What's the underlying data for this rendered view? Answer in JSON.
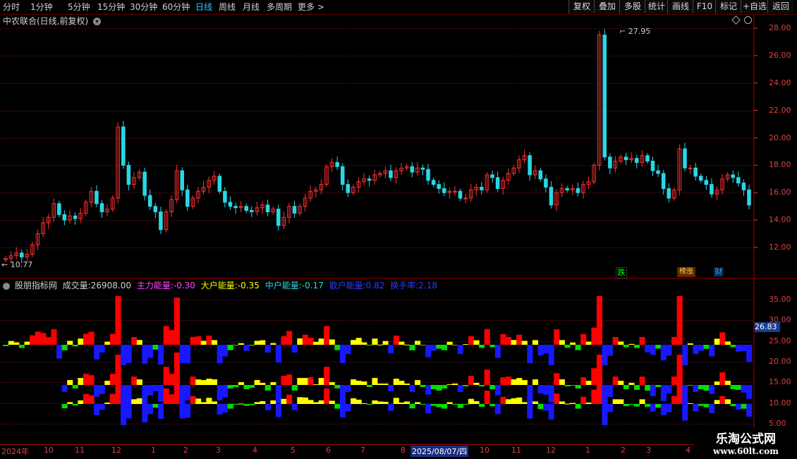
{
  "toolbar": {
    "timeframes": [
      "分时",
      "1分钟",
      "5分钟",
      "15分钟",
      "30分钟",
      "60分钟",
      "日线",
      "周线",
      "月线",
      "多周期",
      "更多 >"
    ],
    "active_timeframe": "日线",
    "buttons": [
      "复权",
      "叠加",
      "多股",
      "统计",
      "画线",
      "F10",
      "标记",
      "+自选",
      "返回"
    ]
  },
  "main_panel": {
    "title": "中农联合(日线,前复权)",
    "y_ticks": [
      "28.00",
      "26.00",
      "24.00",
      "22.00",
      "20.00",
      "18.00",
      "16.00",
      "14.00",
      "12.00"
    ],
    "high_label": "27.95",
    "low_label": "10.77",
    "markers": {
      "die": "跌",
      "bangzhang": "榜涨",
      "cai": "财"
    }
  },
  "indicator_panel": {
    "name": "股朋指标网",
    "volume_label": "成交量:",
    "volume_value": "26908.00",
    "zhuli_label": "主力能量:",
    "zhuli_value": "-0.30",
    "dahu_label": "大户能量:",
    "dahu_value": "-0.35",
    "zhonghu_label": "中户能量:",
    "zhonghu_value": "-0.17",
    "sanhu_label": "散户能量:",
    "sanhu_value": "0.82",
    "huanshou_label": "换手率:",
    "huanshou_value": "2.18",
    "y_ticks": [
      "35.00",
      "30.00",
      "25.00",
      "20.00",
      "15.00",
      "10.00",
      "5.00"
    ],
    "current_value": "26.83"
  },
  "x_axis": {
    "labels": [
      "2024年",
      "10",
      "11",
      "12",
      "1",
      "2",
      "3",
      "4",
      "5",
      "6",
      "7",
      "8",
      "2025/08/07/四",
      "10",
      "11",
      "12",
      "1",
      "2",
      "3",
      "4"
    ]
  },
  "watermark": {
    "line1": "乐淘公式网",
    "line2": "www.60lt.com"
  },
  "colors": {
    "up": "#ff3030",
    "down": "#2ad6e6",
    "yellow": "#ffff00",
    "green": "#00e000",
    "blue": "#1818ff",
    "red": "#ff0000",
    "axis": "#e04040"
  },
  "chart_data": {
    "type": "candlestick",
    "title": "中农联合(日线,前复权)",
    "ylim": [
      10.5,
      29
    ],
    "high": 27.95,
    "low": 10.77,
    "closes": [
      11.2,
      11.4,
      11.6,
      11.3,
      11.5,
      12.2,
      13.0,
      13.8,
      14.2,
      15.2,
      14.4,
      14.0,
      14.3,
      14.1,
      14.5,
      15.3,
      16.1,
      15.2,
      14.6,
      14.8,
      15.6,
      20.8,
      18.0,
      16.6,
      17.1,
      17.5,
      15.8,
      15.0,
      14.6,
      13.3,
      14.6,
      15.5,
      17.6,
      16.2,
      15.0,
      15.6,
      16.1,
      16.4,
      16.9,
      17.2,
      16.1,
      15.3,
      15.0,
      14.9,
      15.0,
      14.7,
      14.6,
      14.9,
      15.1,
      14.6,
      14.8,
      13.6,
      14.2,
      15.0,
      14.5,
      15.0,
      15.6,
      16.1,
      16.2,
      16.6,
      17.9,
      18.2,
      17.9,
      16.6,
      16.0,
      16.4,
      16.8,
      17.0,
      16.9,
      17.3,
      17.4,
      17.6,
      17.1,
      17.6,
      17.8,
      17.9,
      17.5,
      17.8,
      17.7,
      16.9,
      16.6,
      16.3,
      16.0,
      16.1,
      16.1,
      15.6,
      15.6,
      16.2,
      16.4,
      16.2,
      17.3,
      17.1,
      16.3,
      16.9,
      17.4,
      17.8,
      18.4,
      18.7,
      17.3,
      17.6,
      17.0,
      16.4,
      15.1,
      16.0,
      16.3,
      16.2,
      16.3,
      16.0,
      16.6,
      16.8,
      18.0,
      27.5,
      18.6,
      17.8,
      18.3,
      18.6,
      18.4,
      18.5,
      18.2,
      18.7,
      18.3,
      17.6,
      17.4,
      16.3,
      15.6,
      16.2,
      19.2,
      17.8,
      17.8,
      17.2,
      16.9,
      16.6,
      15.9,
      16.2,
      17.0,
      17.3,
      17.1,
      16.7,
      16.2,
      15.1
    ]
  }
}
